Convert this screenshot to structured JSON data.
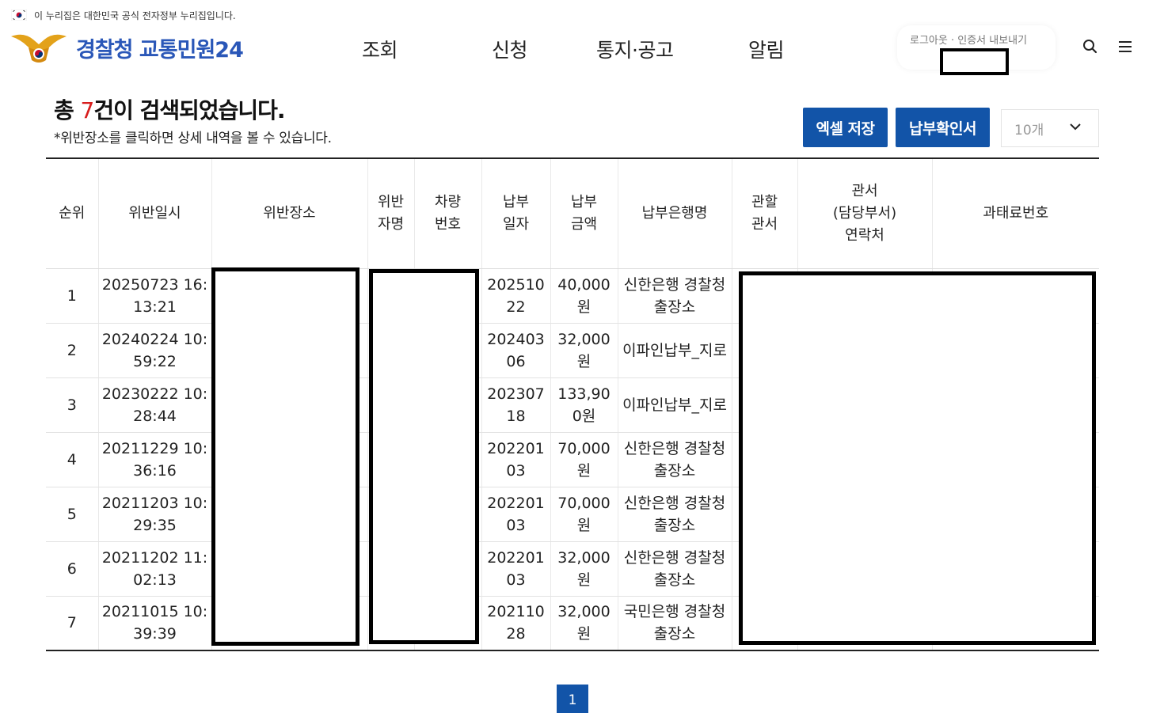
{
  "gov_banner": {
    "text": "이 누리집은 대한민국 공식 전자정부 누리집입니다.",
    "flag_icon": "korea-flag-icon"
  },
  "header": {
    "logo_text": "경찰청 교통민원24",
    "nav": [
      "조회",
      "신청",
      "통지·공고",
      "알림"
    ],
    "auth_text": "로그아웃 · 인증서 내보내기",
    "search_icon": "search-icon",
    "menu_icon": "hamburger-menu-icon"
  },
  "results": {
    "title_prefix": "총 ",
    "count": "7",
    "title_suffix": "건이 검색되었습니다.",
    "note": "*위반장소를 클릭하면 상세 내역을 볼 수 있습니다.",
    "excel_button": "엑셀 저장",
    "confirm_button": "납부확인서",
    "page_size_selected": "10개"
  },
  "table": {
    "headers": [
      "순위",
      "위반일시",
      "위반장소",
      "위반\n자명",
      "차량\n번호",
      "납부\n일자",
      "납부\n금액",
      "납부은행명",
      "관할\n관서",
      "관서\n(담당부서)\n연락처",
      "과태료번호"
    ],
    "rows": [
      {
        "rank": "1",
        "date": "20250723 16:13:21",
        "pay_date": "20251022",
        "amount": "40,000원",
        "bank": "신한은행 경찰청 출장소"
      },
      {
        "rank": "2",
        "date": "20240224 10:59:22",
        "pay_date": "20240306",
        "amount": "32,000원",
        "bank": "이파인납부_지로"
      },
      {
        "rank": "3",
        "date": "20230222 10:28:44",
        "pay_date": "20230718",
        "amount": "133,900원",
        "bank": "이파인납부_지로"
      },
      {
        "rank": "4",
        "date": "20211229 10:36:16",
        "pay_date": "20220103",
        "amount": "70,000원",
        "bank": "신한은행 경찰청 출장소"
      },
      {
        "rank": "5",
        "date": "20211203 10:29:35",
        "pay_date": "20220103",
        "amount": "70,000원",
        "bank": "신한은행 경찰청 출장소"
      },
      {
        "rank": "6",
        "date": "20211202 11:02:13",
        "pay_date": "20220103",
        "amount": "32,000원",
        "bank": "신한은행 경찰청 출장소"
      },
      {
        "rank": "7",
        "date": "20211015 10:39:39",
        "pay_date": "20211028",
        "amount": "32,000원",
        "bank": "국민은행 경찰청 출장소"
      }
    ]
  },
  "pagination": {
    "current": "1"
  },
  "colors": {
    "primary": "#1254a8",
    "logo": "#2a57b8",
    "count_red": "#d81e1e"
  }
}
